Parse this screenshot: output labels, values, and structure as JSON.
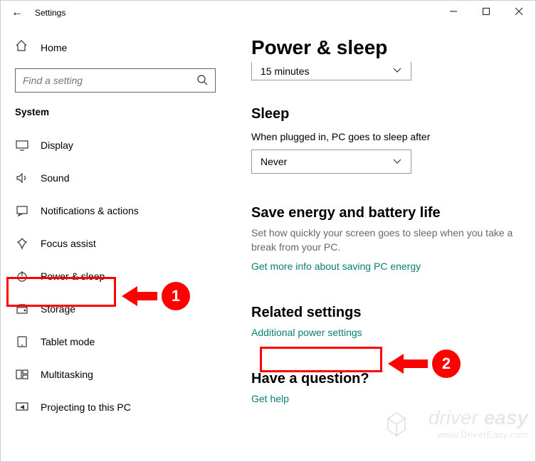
{
  "window": {
    "title": "Settings"
  },
  "sidebar": {
    "home": "Home",
    "search_placeholder": "Find a setting",
    "section": "System",
    "items": [
      {
        "label": "Display"
      },
      {
        "label": "Sound"
      },
      {
        "label": "Notifications & actions"
      },
      {
        "label": "Focus assist"
      },
      {
        "label": "Power & sleep"
      },
      {
        "label": "Storage"
      },
      {
        "label": "Tablet mode"
      },
      {
        "label": "Multitasking"
      },
      {
        "label": "Projecting to this PC"
      }
    ]
  },
  "main": {
    "title": "Power & sleep",
    "screen_dropdown": "15 minutes",
    "sleep_heading": "Sleep",
    "sleep_label": "When plugged in, PC goes to sleep after",
    "sleep_dropdown": "Never",
    "save_heading": "Save energy and battery life",
    "save_desc": "Set how quickly your screen goes to sleep when you take a break from your PC.",
    "save_link": "Get more info about saving PC energy",
    "related_heading": "Related settings",
    "related_link": "Additional power settings",
    "question_heading": "Have a question?",
    "question_link": "Get help"
  },
  "annotations": {
    "one": "1",
    "two": "2"
  },
  "watermark": {
    "brand1": "driver ",
    "brand2": "easy",
    "url": "www.DriverEasy.com"
  }
}
